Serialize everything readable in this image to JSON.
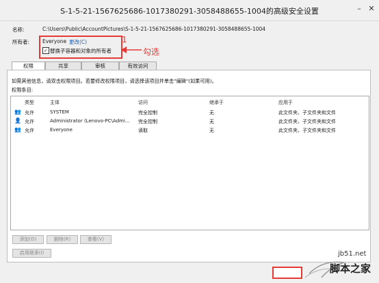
{
  "window": {
    "title": "S-1-5-21-1567625686-1017380291-3058488655-1004的高级安全设置"
  },
  "header": {
    "name_label": "名称:",
    "name_value": "C:\\Users\\Public\\AccountPictures\\S-1-5-21-1567625686-1017380291-3058488655-1004",
    "owner_label": "所有者:",
    "owner_value": "Everyone",
    "change_link": "更改(C)",
    "replace_checkbox_label": "替换子容器和对象的所有者",
    "replace_checked": true
  },
  "annotation": {
    "number": "1",
    "text": "勾选",
    "color": "#e53935"
  },
  "tabs": [
    {
      "label": "权限",
      "active": true
    },
    {
      "label": "共享",
      "active": false
    },
    {
      "label": "审核",
      "active": false
    },
    {
      "label": "有效访问",
      "active": false
    }
  ],
  "info_text": "如需其他信息，请双击权限项目。若要修改权限项目，请选择该项目并单击\"编辑\"(如果可用)。",
  "list_label": "权限条目:",
  "columns": [
    "类型",
    "主体",
    "访问",
    "继承于",
    "应用于"
  ],
  "rows": [
    {
      "type": "允许",
      "principal": "SYSTEM",
      "access": "完全控制",
      "inherit": "无",
      "apply": "此文件夹、子文件夹和文件"
    },
    {
      "type": "允许",
      "principal": "Administrator (Lenovo-PC\\Admi...",
      "access": "完全控制",
      "inherit": "无",
      "apply": "此文件夹、子文件夹和文件"
    },
    {
      "type": "允许",
      "principal": "Everyone",
      "access": "读取",
      "inherit": "无",
      "apply": "此文件夹、子文件夹和文件"
    }
  ],
  "buttons": {
    "add": "添加(D)",
    "remove": "删除(R)",
    "view": "查看(V)",
    "enable_inherit": "启用继承(I)"
  },
  "watermark": {
    "site": "jb51.net",
    "brand": "脚本之家"
  }
}
